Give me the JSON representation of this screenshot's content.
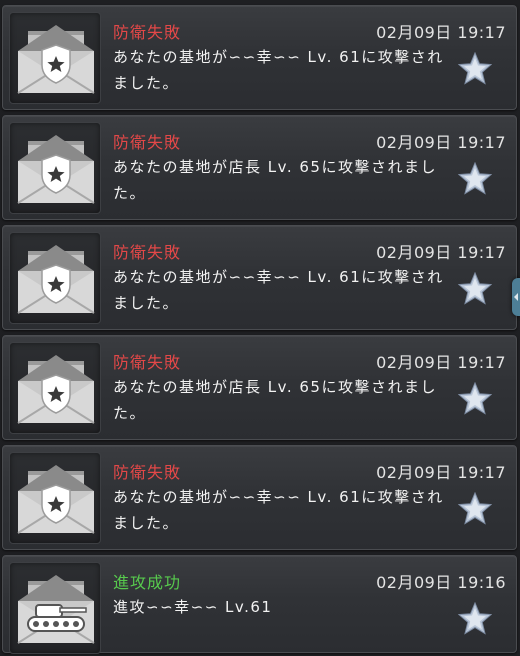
{
  "messages": [
    {
      "title": "防衛失敗",
      "kind": "fail",
      "icon": "shield-envelope-icon",
      "time": "02月09日 19:17",
      "body": [
        "あなたの基地が∽∽幸∽∽ Lv. 61に攻撃され",
        "ました。"
      ]
    },
    {
      "title": "防衛失敗",
      "kind": "fail",
      "icon": "shield-envelope-icon",
      "time": "02月09日 19:17",
      "body": [
        "あなたの基地が店長 Lv. 65に攻撃されまし",
        "た。"
      ]
    },
    {
      "title": "防衛失敗",
      "kind": "fail",
      "icon": "shield-envelope-icon",
      "time": "02月09日 19:17",
      "body": [
        "あなたの基地が∽∽幸∽∽ Lv. 61に攻撃され",
        "ました。"
      ]
    },
    {
      "title": "防衛失敗",
      "kind": "fail",
      "icon": "shield-envelope-icon",
      "time": "02月09日 19:17",
      "body": [
        "あなたの基地が店長 Lv. 65に攻撃されまし",
        "た。"
      ]
    },
    {
      "title": "防衛失敗",
      "kind": "fail",
      "icon": "shield-envelope-icon",
      "time": "02月09日 19:17",
      "body": [
        "あなたの基地が∽∽幸∽∽ Lv. 61に攻撃され",
        "ました。"
      ]
    },
    {
      "title": "進攻成功",
      "kind": "success",
      "icon": "tank-envelope-icon",
      "time": "02月09日 19:16",
      "body": [
        "進攻∽∽幸∽∽ Lv.61",
        ""
      ]
    }
  ],
  "colors": {
    "fail": "#e34848",
    "success": "#57c94d",
    "star": "#aab8cc"
  }
}
